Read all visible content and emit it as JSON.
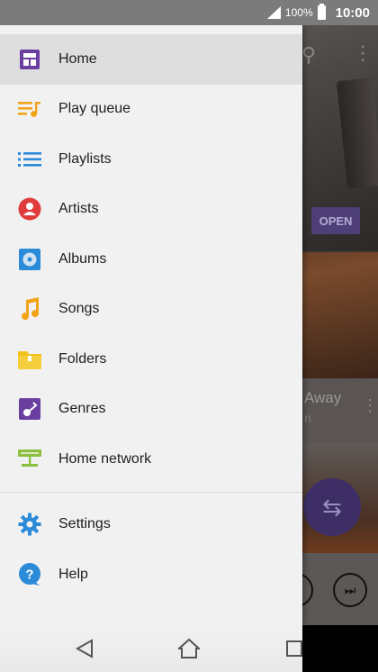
{
  "status_bar": {
    "battery_percent": "100%",
    "time": "10:00",
    "icons": [
      "signal-icon",
      "battery-icon"
    ]
  },
  "drawer": {
    "items": [
      {
        "label": "Home",
        "icon": "home-icon",
        "color": "#6b3fa0",
        "active": true
      },
      {
        "label": "Play queue",
        "icon": "play-queue-icon",
        "color": "#f2a419"
      },
      {
        "label": "Playlists",
        "icon": "playlists-icon",
        "color": "#2c8bd8"
      },
      {
        "label": "Artists",
        "icon": "artists-icon",
        "color": "#e03c3c"
      },
      {
        "label": "Albums",
        "icon": "albums-icon",
        "color": "#2c8bd8"
      },
      {
        "label": "Songs",
        "icon": "songs-icon",
        "color": "#f2a419"
      },
      {
        "label": "Folders",
        "icon": "folders-icon",
        "color": "#f2c21c"
      },
      {
        "label": "Genres",
        "icon": "genres-icon",
        "color": "#6b3fa0"
      },
      {
        "label": "Home network",
        "icon": "home-network-icon",
        "color": "#8cbf3f"
      }
    ],
    "secondary_items": [
      {
        "label": "Settings",
        "icon": "settings-icon",
        "color": "#2c8bd8"
      },
      {
        "label": "Help",
        "icon": "help-icon",
        "color": "#2c8bd8"
      }
    ]
  },
  "background_app": {
    "open_button_label": "OPEN",
    "card_title": "Away",
    "card_subtitle": "ri"
  },
  "nav_bar": {
    "icons": [
      "back-icon",
      "home-nav-icon",
      "recents-icon"
    ]
  },
  "colors": {
    "accent": "#6b3fa0",
    "drawer_bg": "#f1f1f1",
    "active_item_bg": "#dedede"
  }
}
